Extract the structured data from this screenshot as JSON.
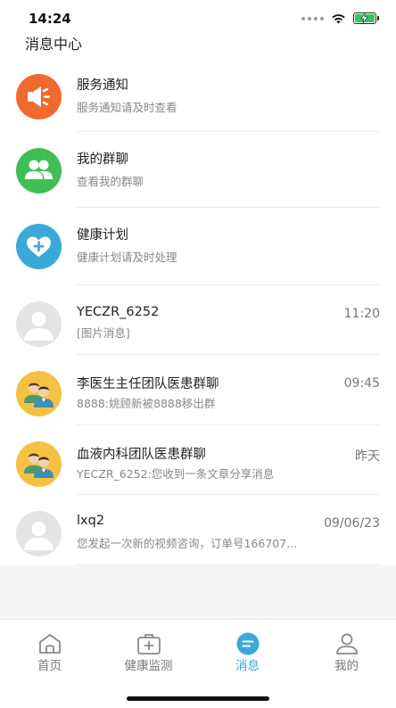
{
  "status_bar": {
    "time": "14:24"
  },
  "header": {
    "title": "消息中心"
  },
  "messages": [
    {
      "title": "服务通知",
      "subtitle": "服务通知请及时查看",
      "time": "",
      "icon": "megaphone-icon",
      "color": "#f0692f"
    },
    {
      "title": "我的群聊",
      "subtitle": "查看我的群聊",
      "time": "",
      "icon": "group-icon",
      "color": "#3fbf56"
    },
    {
      "title": "健康计划",
      "subtitle": "健康计划请及时处理",
      "time": "",
      "icon": "heart-plus-icon",
      "color": "#3aa9d8"
    },
    {
      "title": "YECZR_6252",
      "subtitle": "[图片消息]",
      "time": "11:20",
      "icon": "default-avatar-icon",
      "color": "#e4e4e4"
    },
    {
      "title": "李医生主任团队医患群聊",
      "subtitle": "8888:姚顾新被8888移出群",
      "time": "09:45",
      "icon": "doctor-team-icon",
      "color": "#f5c142"
    },
    {
      "title": "血液内科团队医患群聊",
      "subtitle": "YECZR_6252:您收到一条文章分享消息",
      "time": "昨天",
      "icon": "doctor-team-icon",
      "color": "#f5c142"
    },
    {
      "title": "lxq2",
      "subtitle": "您发起一次新的视频咨询，订单号166707...",
      "time": "09/06/23",
      "icon": "default-avatar-icon",
      "color": "#e4e4e4"
    }
  ],
  "tabs": [
    {
      "label": "首页",
      "icon": "home-icon",
      "active": false
    },
    {
      "label": "健康监测",
      "icon": "medical-kit-icon",
      "active": false
    },
    {
      "label": "消息",
      "icon": "message-icon",
      "active": true
    },
    {
      "label": "我的",
      "icon": "profile-icon",
      "active": false
    }
  ],
  "colors": {
    "accent": "#3aa9d8",
    "battery": "#34c759"
  }
}
